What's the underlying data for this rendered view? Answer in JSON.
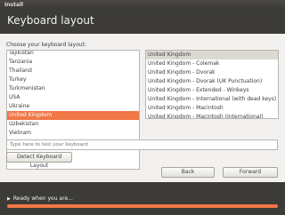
{
  "window": {
    "title": "Install"
  },
  "header": {
    "title": "Keyboard layout"
  },
  "countries": {
    "label": "Choose your keyboard layout:",
    "items": [
      "Tajikistan",
      "Tanzania",
      "Thailand",
      "Turkey",
      "Turkmenistan",
      "USA",
      "Ukraine",
      "United Kingdom",
      "Uzbekistan",
      "Vietnam"
    ],
    "selected": "United Kingdom"
  },
  "layouts": {
    "items": [
      "United Kingdom",
      "United Kingdom - Colemak",
      "United Kingdom - Dvorak",
      "United Kingdom - Dvorak (UK Punctuation)",
      "United Kingdom - Extended - Winkeys",
      "United Kingdom - International (with dead keys)",
      "United Kingdom - Macintosh",
      "United Kingdom - Macintosh (International)"
    ],
    "selected": "United Kingdom"
  },
  "test": {
    "placeholder": "Type here to test your keyboard"
  },
  "buttons": {
    "detect": "Detect Keyboard Layout",
    "back": "Back",
    "forward": "Forward"
  },
  "footer": {
    "status": "Ready when you are...",
    "progress": 1.0
  },
  "colors": {
    "accent": "#f07746",
    "dark": "#3c3b37",
    "panel": "#f2f1f0"
  }
}
